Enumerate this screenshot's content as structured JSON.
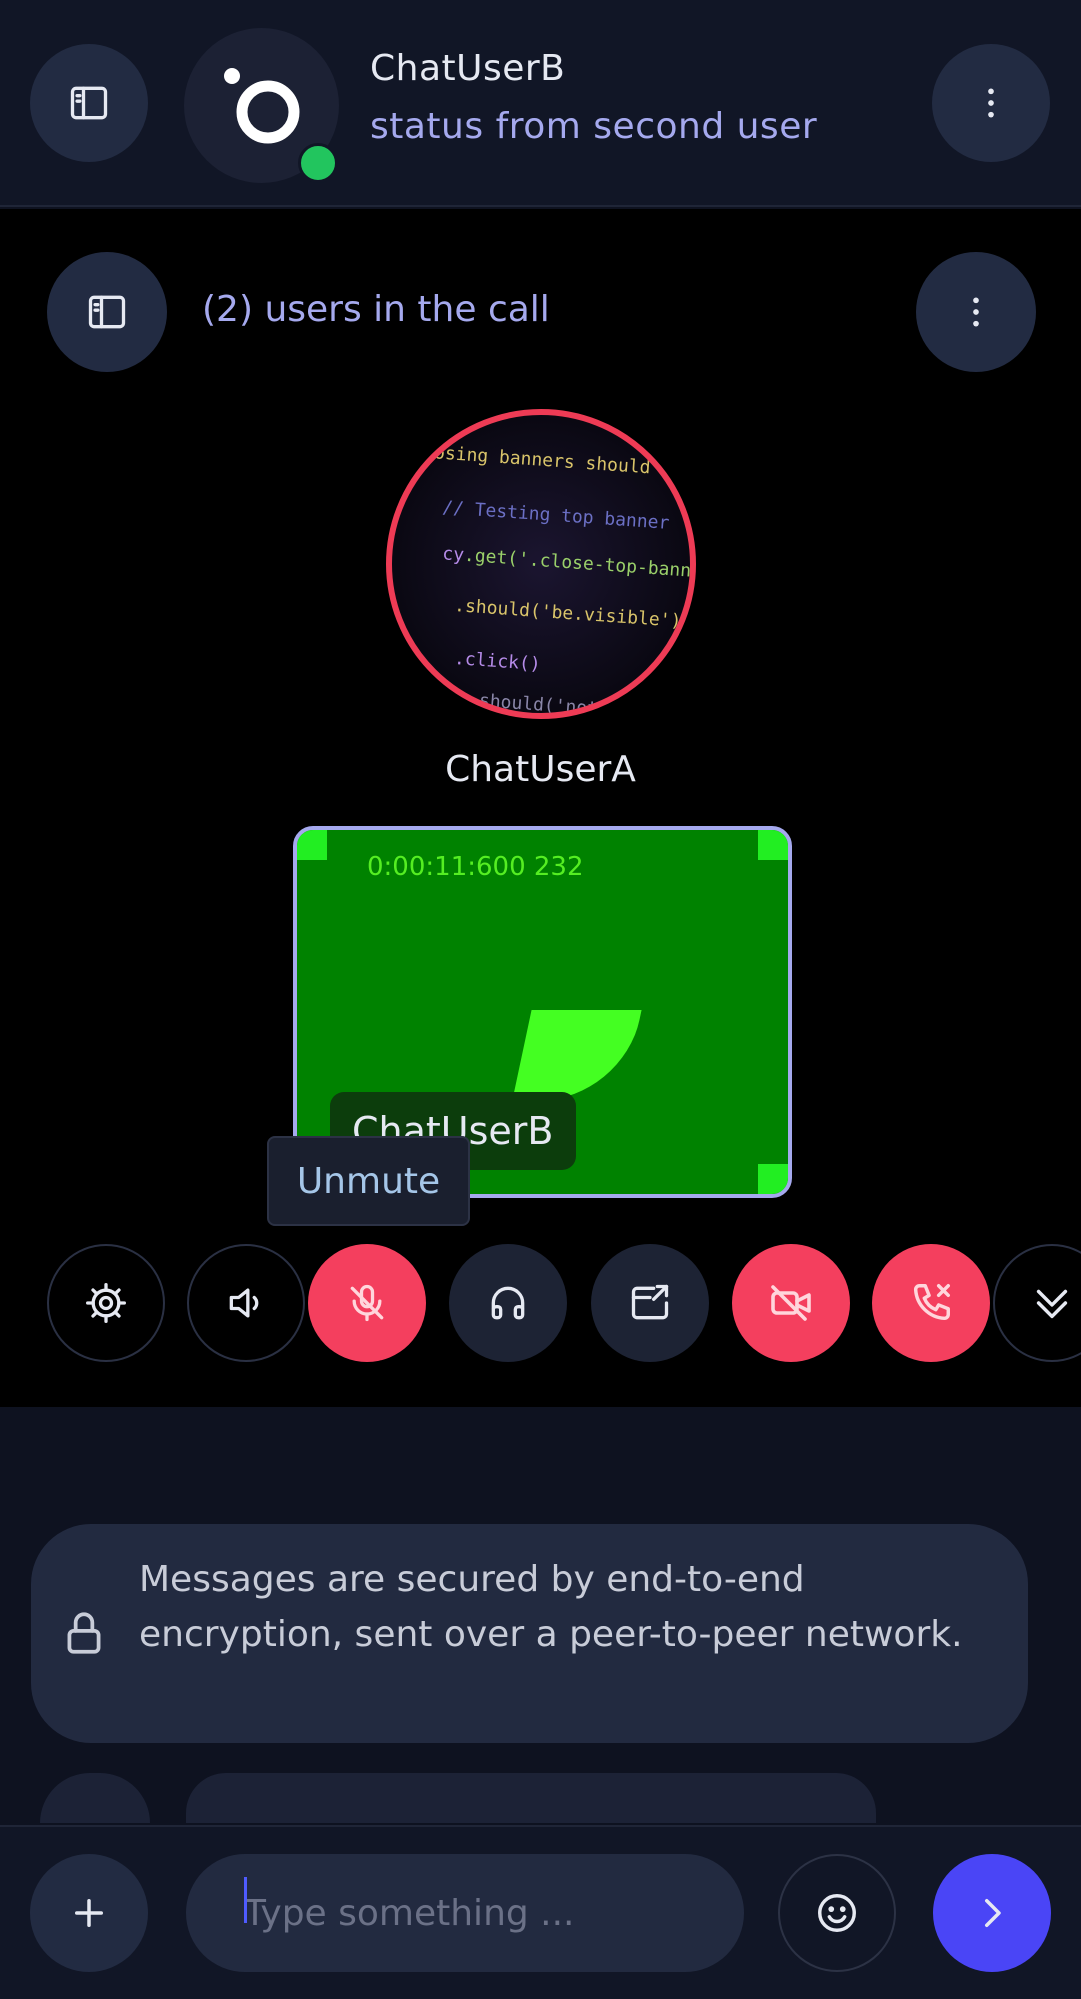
{
  "header": {
    "user_name": "ChatUserB",
    "user_status": "status from second user",
    "online_color": "#22c55e"
  },
  "call": {
    "title": "(2) users in the call",
    "participants": [
      {
        "name": "ChatUserA",
        "ring_color": "#ee3b55"
      },
      {
        "name": "ChatUserB",
        "frame_color": "#a5a9ee"
      }
    ],
    "video_timecode": "0:00:11:600 232",
    "tooltip": "Unmute",
    "controls": [
      {
        "name": "settings",
        "icon": "gear-icon",
        "style": "outline"
      },
      {
        "name": "speaker",
        "icon": "speaker-icon",
        "style": "outline"
      },
      {
        "name": "microphone-muted",
        "icon": "mic-off-icon",
        "style": "red"
      },
      {
        "name": "headphones",
        "icon": "headphones-icon",
        "style": "dark"
      },
      {
        "name": "screen-share",
        "icon": "screen-share-icon",
        "style": "dark"
      },
      {
        "name": "camera-off",
        "icon": "video-off-icon",
        "style": "red"
      },
      {
        "name": "hang-up",
        "icon": "phone-x-icon",
        "style": "red"
      },
      {
        "name": "collapse",
        "icon": "chevrons-down-icon",
        "style": "outline"
      }
    ]
  },
  "chat": {
    "encryption_notice": "Messages are secured by end-to-end encryption, sent over a peer-to-peer network."
  },
  "composer": {
    "placeholder": "Type something ..."
  },
  "colors": {
    "accent": "#4f46e5",
    "danger": "#f43f5e",
    "send_button": "#4a45f6"
  }
}
